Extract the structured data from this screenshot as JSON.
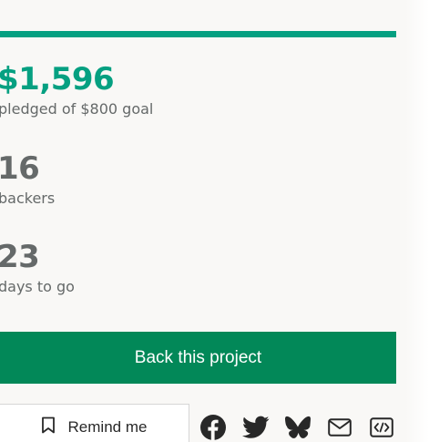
{
  "campaign": {
    "progress_fraction": 1.0,
    "pledged_amount": "$1,596",
    "pledged_label": "pledged of $800 goal",
    "backers_count": "16",
    "backers_label": "backers",
    "days_count": "23",
    "days_label": "days to go"
  },
  "actions": {
    "back_label": "Back this project",
    "remind_label": "Remind me"
  },
  "share": {
    "icons": [
      "facebook-icon",
      "twitter-icon",
      "bluesky-icon",
      "email-icon",
      "embed-icon"
    ]
  },
  "colors": {
    "accent": "#05a081",
    "button": "#028858",
    "text_muted": "#656969"
  }
}
